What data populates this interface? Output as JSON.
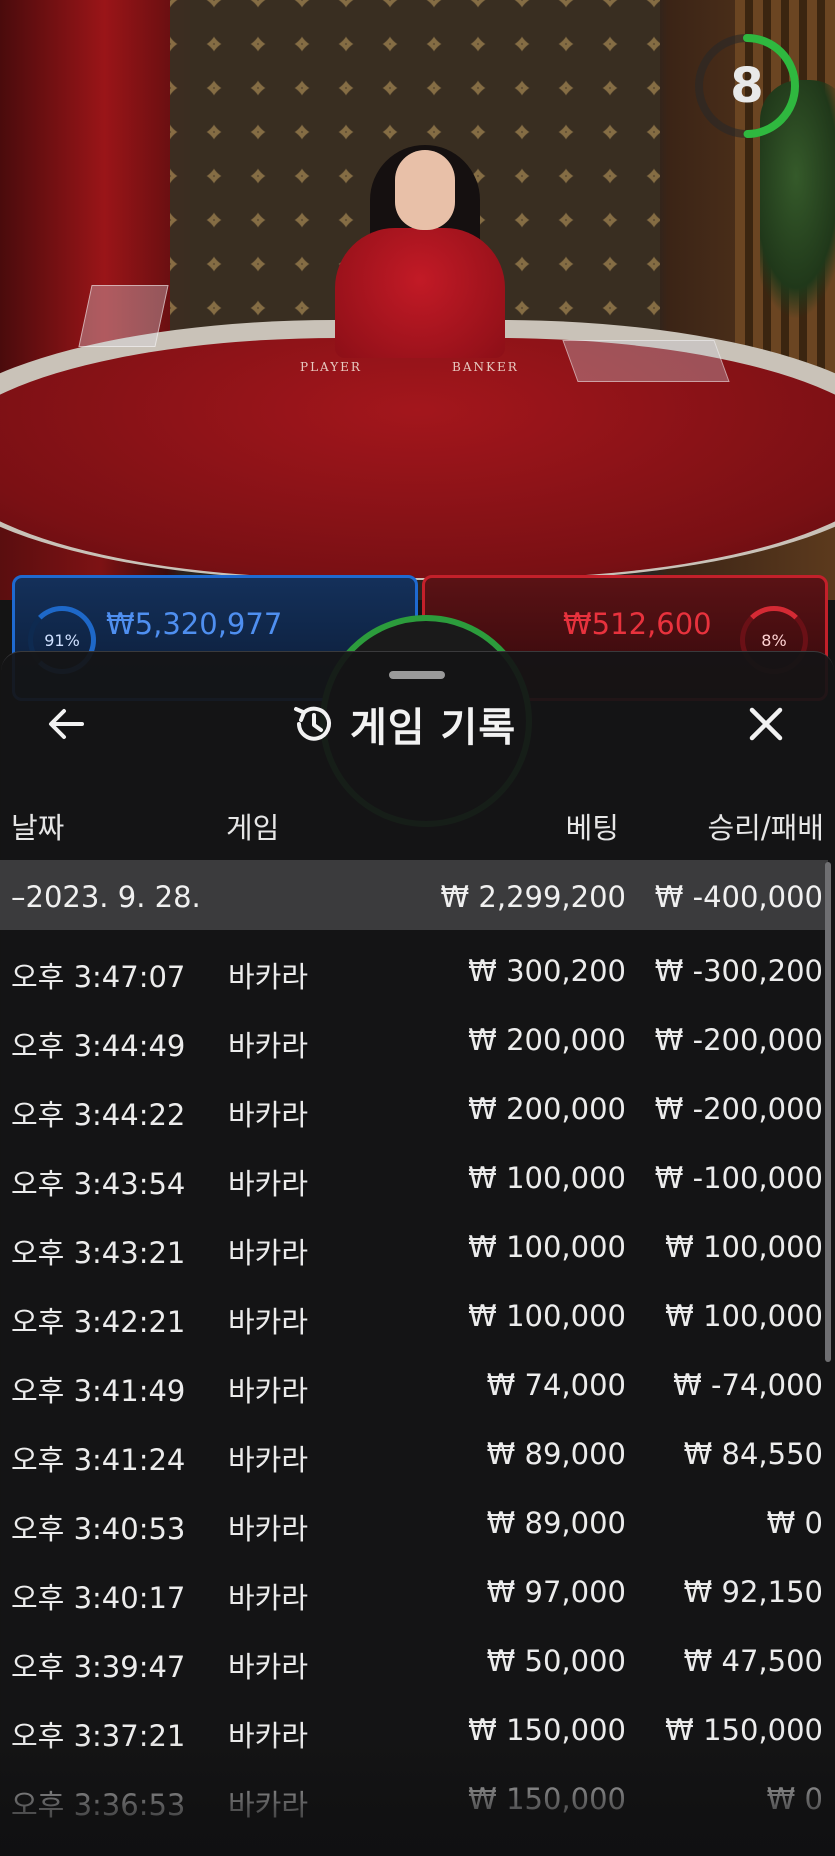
{
  "game_view": {
    "timer": "8",
    "table_labels": {
      "player": "PLAYER",
      "banker": "BANKER"
    },
    "player_bet": {
      "percent": "91%",
      "amount": "₩5,320,977",
      "percent_value": 0.91
    },
    "banker_bet": {
      "percent": "8%",
      "amount": "₩512,600",
      "percent_value": 0.08
    }
  },
  "sheet": {
    "title": "게임 기록",
    "back_icon": "arrow-left-icon",
    "history_icon": "history-icon",
    "close_icon": "close-icon"
  },
  "columns": {
    "date": "날짜",
    "game": "게임",
    "bet": "베팅",
    "win_loss": "승리/패배"
  },
  "day_group": {
    "date": "–2023. 9. 28.",
    "bet_total": "₩ 2,299,200",
    "win_loss_total": "₩ -400,000"
  },
  "rows": [
    {
      "time": "오후 3:47:07",
      "game": "바카라",
      "bet": "₩ 300,200",
      "win_loss": "₩ -300,200"
    },
    {
      "time": "오후 3:44:49",
      "game": "바카라",
      "bet": "₩ 200,000",
      "win_loss": "₩ -200,000"
    },
    {
      "time": "오후 3:44:22",
      "game": "바카라",
      "bet": "₩ 200,000",
      "win_loss": "₩ -200,000"
    },
    {
      "time": "오후 3:43:54",
      "game": "바카라",
      "bet": "₩ 100,000",
      "win_loss": "₩ -100,000"
    },
    {
      "time": "오후 3:43:21",
      "game": "바카라",
      "bet": "₩ 100,000",
      "win_loss": "₩ 100,000"
    },
    {
      "time": "오후 3:42:21",
      "game": "바카라",
      "bet": "₩ 100,000",
      "win_loss": "₩ 100,000"
    },
    {
      "time": "오후 3:41:49",
      "game": "바카라",
      "bet": "₩ 74,000",
      "win_loss": "₩ -74,000"
    },
    {
      "time": "오후 3:41:24",
      "game": "바카라",
      "bet": "₩ 89,000",
      "win_loss": "₩ 84,550"
    },
    {
      "time": "오후 3:40:53",
      "game": "바카라",
      "bet": "₩ 89,000",
      "win_loss": "₩ 0"
    },
    {
      "time": "오후 3:40:17",
      "game": "바카라",
      "bet": "₩ 97,000",
      "win_loss": "₩ 92,150"
    },
    {
      "time": "오후 3:39:47",
      "game": "바카라",
      "bet": "₩ 50,000",
      "win_loss": "₩ 47,500"
    },
    {
      "time": "오후 3:37:21",
      "game": "바카라",
      "bet": "₩ 150,000",
      "win_loss": "₩ 150,000"
    },
    {
      "time": "오후 3:36:53",
      "game": "바카라",
      "bet": "₩ 150,000",
      "win_loss": "₩ 0"
    }
  ],
  "colors": {
    "player": "#1f6ad0",
    "banker": "#c3202a",
    "timer": "#2fb83f"
  }
}
